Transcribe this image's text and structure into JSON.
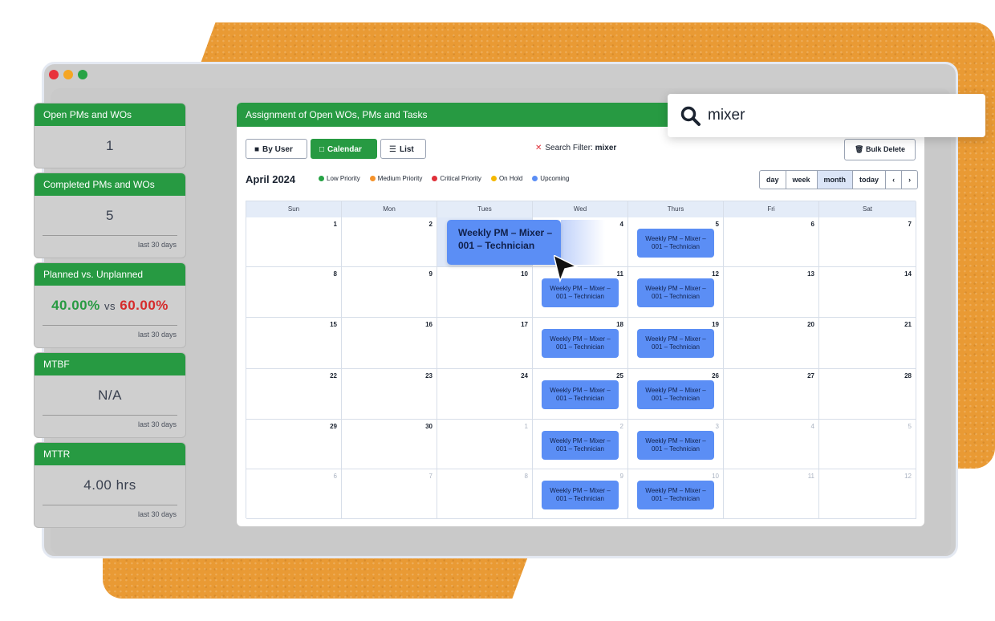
{
  "colors": {
    "accent_green": "#279a42",
    "event_blue": "#5b8ef5",
    "orange_bg": "#e99a34",
    "red": "#d62b2b"
  },
  "stats": [
    {
      "title": "Open PMs and WOs",
      "value": "1",
      "subtitle": ""
    },
    {
      "title": "Completed PMs and WOs",
      "value": "5",
      "subtitle": "last 30 days"
    },
    {
      "title": "Planned vs. Unplanned",
      "value_planned": "40.00%",
      "vs": "vs",
      "value_unplanned": "60.00%",
      "subtitle": "last 30 days"
    },
    {
      "title": "MTBF",
      "value": "N/A",
      "subtitle": "last 30 days"
    },
    {
      "title": "MTTR",
      "value": "4.00 hrs",
      "subtitle": "last 30 days"
    }
  ],
  "panel": {
    "title": "Assignment of Open WOs, PMs and Tasks",
    "buttons": {
      "by_user": "By User",
      "calendar": "Calendar",
      "list": "List"
    },
    "filter_label": "Search Filter:",
    "filter_value": "mixer",
    "bulk_delete": "Bulk Delete",
    "month_label": "April 2024",
    "legend": [
      {
        "label": "Low Priority",
        "color": "#27a345"
      },
      {
        "label": "Medium Priority",
        "color": "#f5922a"
      },
      {
        "label": "Critical Priority",
        "color": "#e0303a"
      },
      {
        "label": "On Hold",
        "color": "#f5b800"
      },
      {
        "label": "Upcoming",
        "color": "#5b8ef5"
      }
    ],
    "views": {
      "day": "day",
      "week": "week",
      "month": "month",
      "today": "today",
      "prev": "‹",
      "next": "›"
    },
    "days_of_week": [
      "Sun",
      "Mon",
      "Tues",
      "Wed",
      "Thurs",
      "Fri",
      "Sat"
    ],
    "weeks": [
      [
        "1",
        "2",
        "3",
        "4",
        "5",
        "6",
        "7"
      ],
      [
        "8",
        "9",
        "10",
        "11",
        "12",
        "13",
        "14"
      ],
      [
        "15",
        "16",
        "17",
        "18",
        "19",
        "20",
        "21"
      ],
      [
        "22",
        "23",
        "24",
        "25",
        "26",
        "27",
        "28"
      ],
      [
        "29",
        "30",
        "1",
        "2",
        "3",
        "4",
        "5"
      ],
      [
        "6",
        "7",
        "8",
        "9",
        "10",
        "11",
        "12"
      ]
    ],
    "event_text": "Weekly PM – Mixer – 001 – Technician",
    "dragging_event": "Weekly PM – Mixer – 001 – Technician"
  },
  "search": {
    "icon": "search-icon",
    "query": "mixer"
  }
}
